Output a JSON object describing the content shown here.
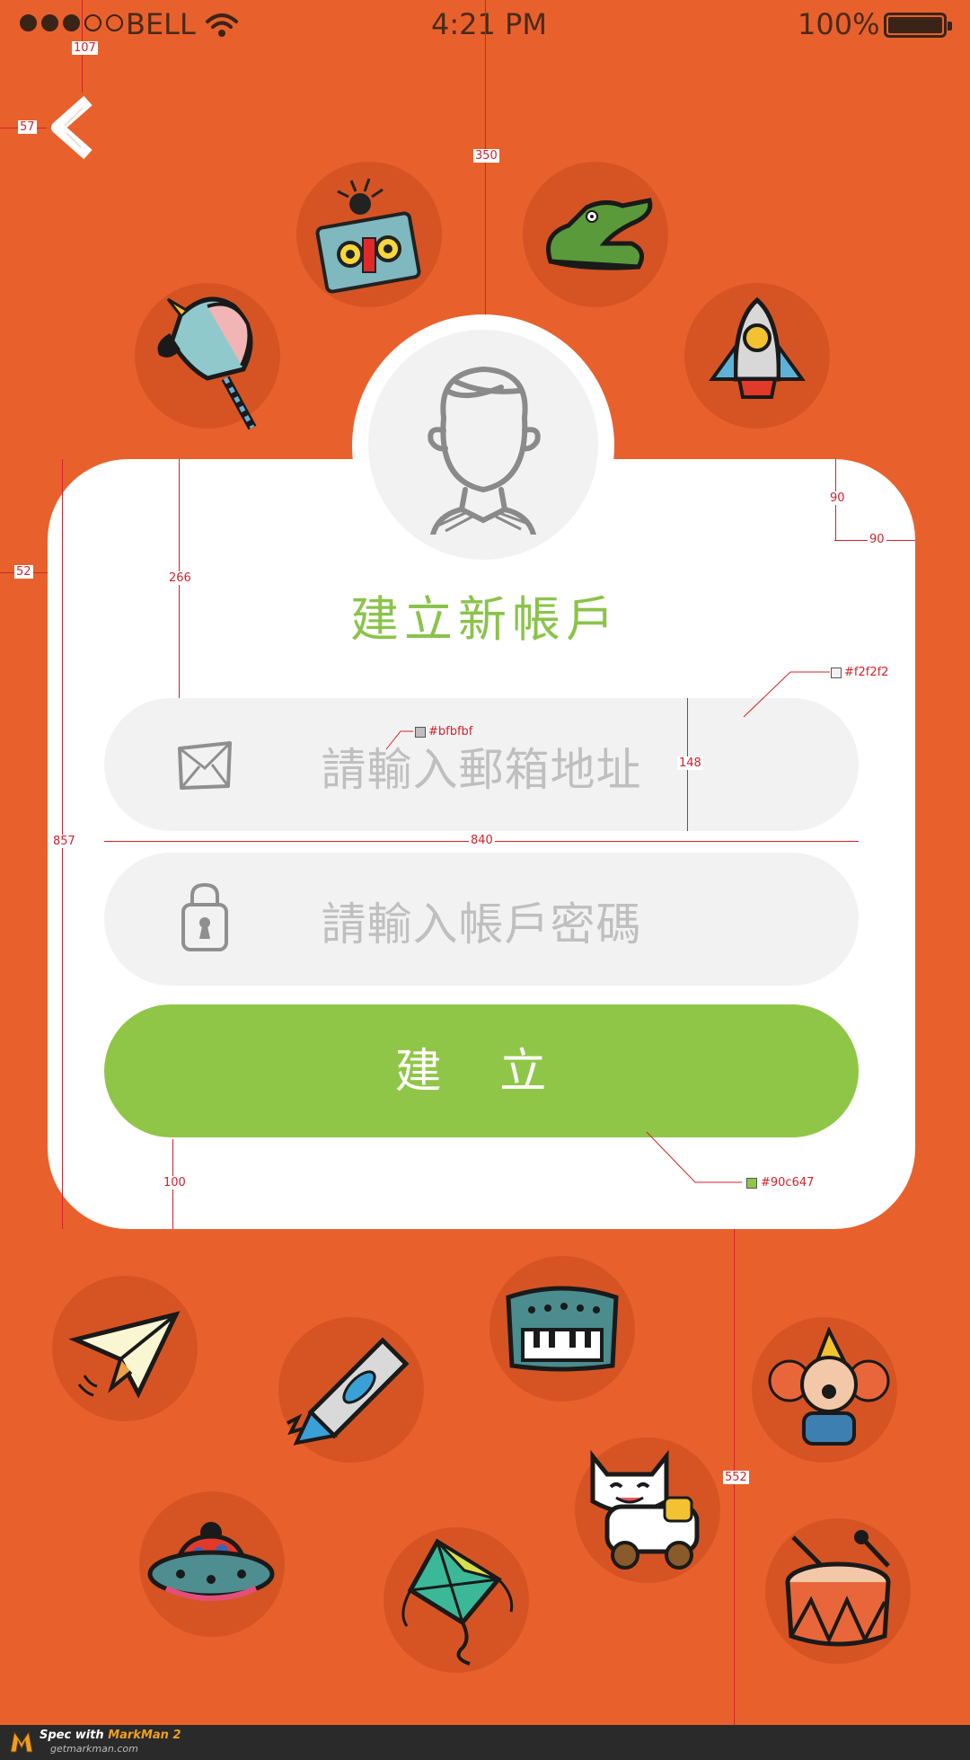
{
  "status_bar": {
    "carrier": "BELL",
    "time": "4:21 PM",
    "battery": "100%",
    "signal_dots_filled": 3,
    "signal_dots_total": 5
  },
  "icons": {
    "back": "chevron-left-icon",
    "avatar": "user-avatar-icon",
    "email": "envelope-icon",
    "password": "lock-icon"
  },
  "title": "建立新帳戶",
  "email": {
    "placeholder": "請輸入郵箱地址",
    "value": ""
  },
  "password": {
    "placeholder": "請輸入帳戶密碼",
    "value": ""
  },
  "submit_label": "建 立",
  "colors": {
    "background": "#e8612c",
    "card": "#ffffff",
    "field": "#f2f2f2",
    "placeholder": "#bfbfbf",
    "accent": "#90c647"
  },
  "annotations": {
    "a107": "107",
    "a57": "57",
    "a350": "350",
    "a90_top": "90",
    "a90_side": "90",
    "a52": "52",
    "a266": "266",
    "a148": "148",
    "a840": "840",
    "a857": "857",
    "a100": "100",
    "a552": "552",
    "c_field": "#f2f2f2",
    "c_placeholder": "#bfbfbf",
    "c_accent": "#90c647"
  },
  "footer": {
    "brand_prefix": "Spec with ",
    "brand_name": "MarkMan 2",
    "url": "getmarkman.com"
  }
}
